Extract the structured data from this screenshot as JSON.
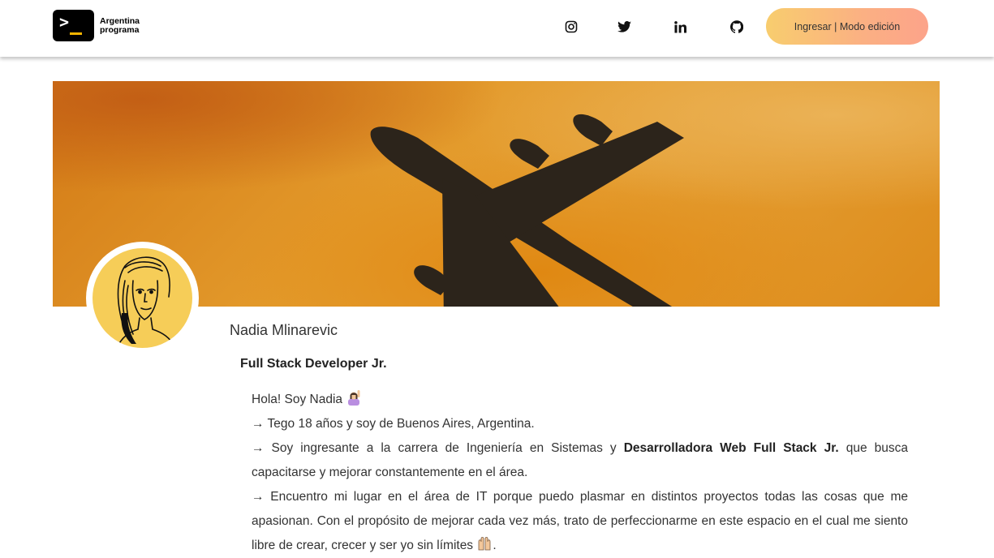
{
  "header": {
    "logo_line1": "Argentina",
    "logo_line2": "programa",
    "social_icons": [
      "instagram-icon",
      "twitter-icon",
      "linkedin-icon",
      "github-icon"
    ],
    "login_button": "Ingresar | Modo edición"
  },
  "profile": {
    "name": "Nadia Mlinarevic",
    "title": "Full Stack Developer Jr.",
    "about": {
      "greeting": "Hola! Soy Nadia",
      "line1": "→ Tego 18 años y soy de Buenos Aires, Argentina.",
      "line2_start": "→ Soy ingresante a la carrera de Ingeniería en Sistemas y ",
      "line2_bold": "Desarrolladora Web Full Stack Jr.",
      "line2_end": " que busca capacitarse y mejorar constantemente en el área.",
      "line3": "→ Encuentro mi lugar en el área de IT porque puedo plasmar en distintos proyectos todas las cosas que me apasionan. Con el propósito de mejorar cada vez más, trato de perfeccionarme en este espacio en el cual me siento libre de crear, crecer y ser yo sin límites",
      "line3_end": "."
    }
  },
  "colors": {
    "button_gradient_start": "#f8cd6e",
    "button_gradient_end": "#fca38a",
    "avatar_bg": "#f6cd58",
    "banner_orange": "#e39a2b",
    "plane_silhouette": "#2c241b"
  }
}
